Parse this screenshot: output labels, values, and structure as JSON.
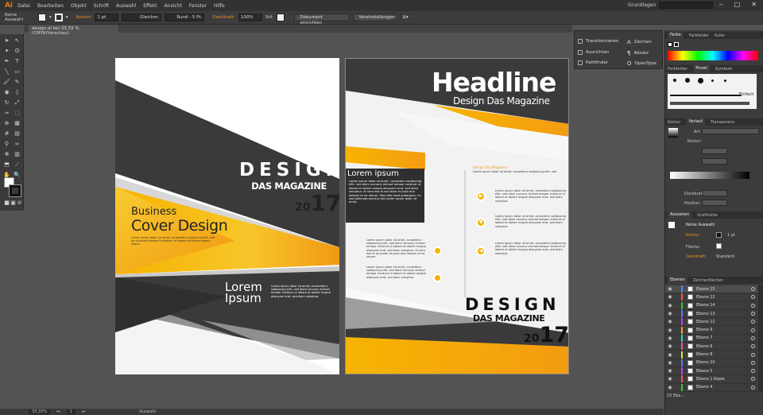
{
  "app": {
    "logo": "Ai"
  },
  "menu": [
    "Datei",
    "Bearbeiten",
    "Objekt",
    "Schrift",
    "Auswahl",
    "Effekt",
    "Ansicht",
    "Fenster",
    "Hilfe"
  ],
  "workspace": "Grundlagen",
  "control": {
    "selection": "Keine Auswahl",
    "stroke_label": "Kontur:",
    "stroke_weight": "1 pt",
    "stroke_style": "Gleichm.",
    "brush": "Rund - 5 Pt.",
    "opacity_label": "Deckkraft:",
    "opacity": "100%",
    "style_label": "Stil:",
    "doc_setup": "Dokument einrichten",
    "preferences": "Voreinstellungen"
  },
  "doc_tab": "design.ai bei 33,33 % (CMYK/Vorschau)",
  "status": {
    "zoom": "33,33%",
    "page": "1",
    "info": "Auswahl"
  },
  "cover": {
    "design": "DESIGN",
    "magazine": "DAS MAGAZINE",
    "year_small": "20",
    "year_big": "17",
    "business": "Business",
    "cover_design": "Cover Design",
    "small_text": "Lorem ipsum dolor sit amet, consectetur adipiscing elit, sed do eiusmod tempor incididunt ut labore et dolore magna aliqua",
    "lorem1": "Lorem",
    "lorem2": "Ipsum",
    "lorem_text": "Lorem ipsum dolor sit amet, consectetur sadipscing elitr, sed diam nonumy eirmod tempor invidunt ut labore et dolore magna aliquyam erat, sed diam voluptua."
  },
  "back": {
    "headline": "Headline",
    "subheadline": "Design Das Magazine",
    "lorem_title": "Lorem ipsum",
    "box_text": "Lorem ipsum dolor sit amet, consetetur sadipscing elitr, sed diam nonumy eirmod tempor invidunt ut labore et dolore magna aliquyam erat, sed diam voluptua. At vero eos et accusam et justo duo dolores et ea rebum. Stet clita kasd gubergren, no sea takimata sanctus est Lorem ipsum dolor sit amet.",
    "orange_label": "Design Das Magazine",
    "top_text": "Lorem ipsum dolor sit amet, consetetur sadipscing elitr, sed",
    "item_text": "Lorem ipsum dolor sit amet, consetetur sadipscing elitr, sed diam nonumy eirmod tempor invidunt ut labore et dolore magna aliquyam erat, sed diam voluptua.",
    "left_text": "Lorem ipsum dolor sit amet, consetetur sadipscing elitr, sed diam nonumy eirmod tempor invidunt ut labore et dolore magna aliquyam erat, sed diam voluptua. At vero eos et accusam et justo duo dolores et ea rebum.",
    "design": "DESIGN",
    "magazine": "DAS MAGAZINE",
    "year_small": "20",
    "year_big": "17"
  },
  "float_panel": {
    "transform": "Transformieren",
    "align": "Ausrichten",
    "pathfinder": "Pathfinder",
    "chars": "Zeichen",
    "para": "Absatz",
    "opentype": "OpenType"
  },
  "panels": {
    "farbe_tabs": [
      "Farbe",
      "Farbfelder",
      "Kuler"
    ],
    "brush_tabs": [
      "Farbfelder",
      "Pinsel",
      "Symbole"
    ],
    "brush_label": "Einfach",
    "gradient_tabs": [
      "Kontur",
      "Verlauf",
      "Transparenz"
    ],
    "gradient_type": "Art:",
    "gradient_kontur": "Kontur:",
    "gradient_opacity": "Deckkraft:",
    "gradient_position": "Position:",
    "appearance_tabs": [
      "Aussehen",
      "Grafikstile"
    ],
    "appearance_title": "Keine Auswahl",
    "appearance_stroke": "Kontur:",
    "appearance_stroke_val": "1 pt",
    "appearance_fill": "Fläche:",
    "appearance_opacity": "Deckkraft:",
    "appearance_opacity_val": "Standard",
    "layers_tabs": [
      "Ebenen",
      "Zeichenflächen"
    ],
    "layers_count": "15 Ebe..."
  },
  "layers": [
    {
      "name": "Ebene 15",
      "color": "#4f7fff"
    },
    {
      "name": "Ebene 12",
      "color": "#ff5050"
    },
    {
      "name": "Ebene 14",
      "color": "#38c738"
    },
    {
      "name": "Ebene 13",
      "color": "#4f7fff"
    },
    {
      "name": "Ebene 11",
      "color": "#c040ff"
    },
    {
      "name": "Ebene 9",
      "color": "#ff9f30"
    },
    {
      "name": "Ebene 7",
      "color": "#30d0d0"
    },
    {
      "name": "Ebene 6",
      "color": "#ff50b0"
    },
    {
      "name": "Ebene 8",
      "color": "#e0e030"
    },
    {
      "name": "Ebene 10",
      "color": "#4f7fff"
    },
    {
      "name": "Ebene 5",
      "color": "#c040ff"
    },
    {
      "name": "Ebene 1 Kopie",
      "color": "#ff5050"
    },
    {
      "name": "Ebene 4",
      "color": "#38c738"
    }
  ]
}
